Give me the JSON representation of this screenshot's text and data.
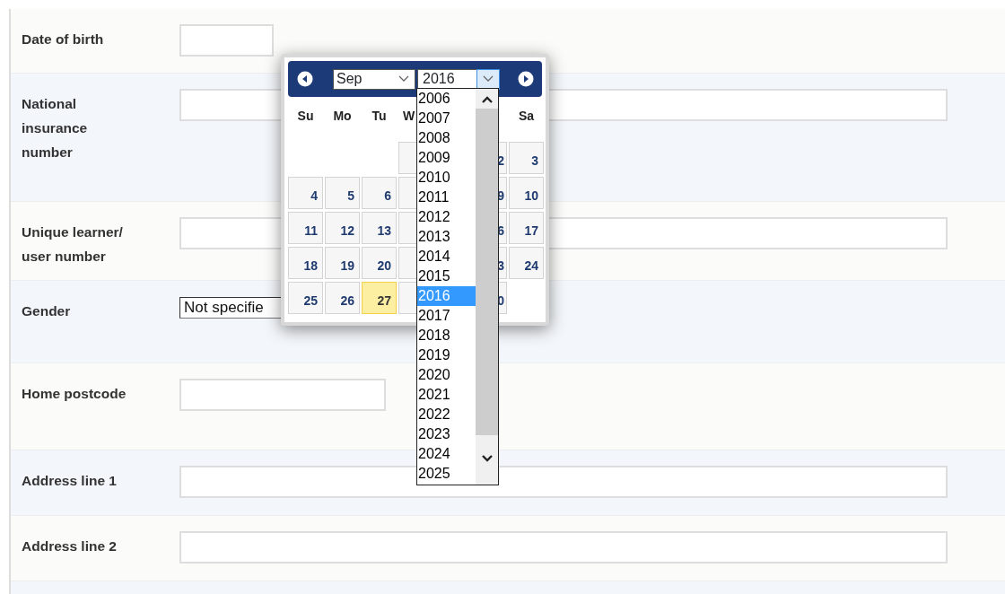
{
  "form": {
    "fields": [
      {
        "label": "Date of birth",
        "kind": "text"
      },
      {
        "label": "National insurance number",
        "kind": "text"
      },
      {
        "label": "Unique learner/ user number",
        "kind": "text"
      },
      {
        "label": "Gender",
        "kind": "select",
        "value": "Not specifie"
      },
      {
        "label": "Home postcode",
        "kind": "text"
      },
      {
        "label": "Address line 1",
        "kind": "text"
      },
      {
        "label": "Address line 2",
        "kind": "text"
      }
    ]
  },
  "datepicker": {
    "month": "Sep",
    "year": "2016",
    "year_list_open": true,
    "weekdays": [
      {
        "kind": "label",
        "text": "Su"
      },
      {
        "kind": "label",
        "text": "Mo"
      },
      {
        "kind": "label",
        "text": "Tu"
      },
      {
        "kind": "label",
        "text": "W"
      },
      {
        "kind": "covered"
      },
      {
        "kind": "covered"
      },
      {
        "kind": "label",
        "text": "Sa"
      }
    ],
    "weeks": [
      [
        {
          "kind": "empty"
        },
        {
          "kind": "empty"
        },
        {
          "kind": "empty"
        },
        {
          "kind": "covered"
        },
        {
          "kind": "hidden"
        },
        {
          "kind": "day",
          "text": "2",
          "today": false
        },
        {
          "kind": "day",
          "text": "3",
          "today": false
        }
      ],
      [
        {
          "kind": "day",
          "text": "4",
          "today": false
        },
        {
          "kind": "day",
          "text": "5",
          "today": false
        },
        {
          "kind": "day",
          "text": "6",
          "today": false
        },
        {
          "kind": "covered"
        },
        {
          "kind": "hidden"
        },
        {
          "kind": "day",
          "text": "9",
          "today": false
        },
        {
          "kind": "day",
          "text": "10",
          "today": false
        }
      ],
      [
        {
          "kind": "day",
          "text": "11",
          "today": false
        },
        {
          "kind": "day",
          "text": "12",
          "today": false
        },
        {
          "kind": "day",
          "text": "13",
          "today": false
        },
        {
          "kind": "covered"
        },
        {
          "kind": "hidden"
        },
        {
          "kind": "day",
          "text": "6",
          "today": false
        },
        {
          "kind": "day",
          "text": "17",
          "today": false
        }
      ],
      [
        {
          "kind": "day",
          "text": "18",
          "today": false
        },
        {
          "kind": "day",
          "text": "19",
          "today": false
        },
        {
          "kind": "day",
          "text": "20",
          "today": false
        },
        {
          "kind": "covered"
        },
        {
          "kind": "hidden"
        },
        {
          "kind": "day",
          "text": "3",
          "today": false
        },
        {
          "kind": "day",
          "text": "24",
          "today": false
        }
      ],
      [
        {
          "kind": "day",
          "text": "25",
          "today": false
        },
        {
          "kind": "day",
          "text": "26",
          "today": false
        },
        {
          "kind": "day",
          "text": "27",
          "today": true
        },
        {
          "kind": "covered"
        },
        {
          "kind": "hidden"
        },
        {
          "kind": "day",
          "text": "0",
          "today": false
        },
        {
          "kind": "empty"
        }
      ]
    ],
    "years": [
      {
        "text": "2006",
        "selected": false
      },
      {
        "text": "2007",
        "selected": false
      },
      {
        "text": "2008",
        "selected": false
      },
      {
        "text": "2009",
        "selected": false
      },
      {
        "text": "2010",
        "selected": false
      },
      {
        "text": "2011",
        "selected": false
      },
      {
        "text": "2012",
        "selected": false
      },
      {
        "text": "2013",
        "selected": false
      },
      {
        "text": "2014",
        "selected": false
      },
      {
        "text": "2015",
        "selected": false
      },
      {
        "text": "2016",
        "selected": true
      },
      {
        "text": "2017",
        "selected": false
      },
      {
        "text": "2018",
        "selected": false
      },
      {
        "text": "2019",
        "selected": false
      },
      {
        "text": "2020",
        "selected": false
      },
      {
        "text": "2021",
        "selected": false
      },
      {
        "text": "2022",
        "selected": false
      },
      {
        "text": "2023",
        "selected": false
      },
      {
        "text": "2024",
        "selected": false
      },
      {
        "text": "2025",
        "selected": false
      }
    ]
  }
}
